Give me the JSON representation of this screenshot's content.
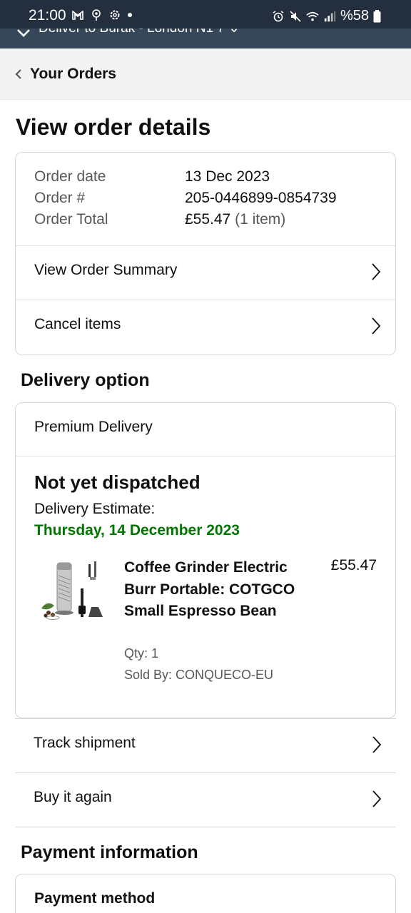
{
  "status_bar": {
    "time": "21:00",
    "battery": "%58",
    "icons": [
      "gmail-icon",
      "location-icon",
      "settings-icon",
      "dot-icon",
      "alarm-icon",
      "mute-icon",
      "wifi-icon",
      "signal-icon",
      "battery-icon"
    ]
  },
  "deliver_to": {
    "text": "Deliver to Burak - London N1 7 ⌄"
  },
  "breadcrumb": {
    "label": "Your Orders"
  },
  "page": {
    "title": "View order details"
  },
  "order": {
    "date_label": "Order date",
    "date_value": "13 Dec 2023",
    "number_label": "Order #",
    "number_value": "205-0446899-0854739",
    "total_label": "Order Total",
    "total_value": "£55.47",
    "total_items": "(1 item)",
    "view_summary": "View Order Summary",
    "cancel_items": "Cancel items"
  },
  "delivery": {
    "heading": "Delivery option",
    "option": "Premium Delivery",
    "status": "Not yet dispatched",
    "estimate_label": "Delivery Estimate:",
    "estimate_date": "Thursday, 14 December 2023",
    "product": {
      "title": "Coffee Grinder Electric Burr Portable: COTGCO Small Espresso Bean",
      "price": "£55.47",
      "qty": "Qty: 1",
      "seller": "Sold By: CONQUECO-EU"
    }
  },
  "actions": {
    "track": "Track shipment",
    "buy_again": "Buy it again"
  },
  "payment": {
    "heading": "Payment information",
    "method_label": "Payment method"
  },
  "colors": {
    "header_dark": "#232f3e",
    "header_strip": "#37475a",
    "breadcrumb_bg": "#f3f3f3",
    "estimate_green": "#007600",
    "border": "#d5d9d9"
  }
}
